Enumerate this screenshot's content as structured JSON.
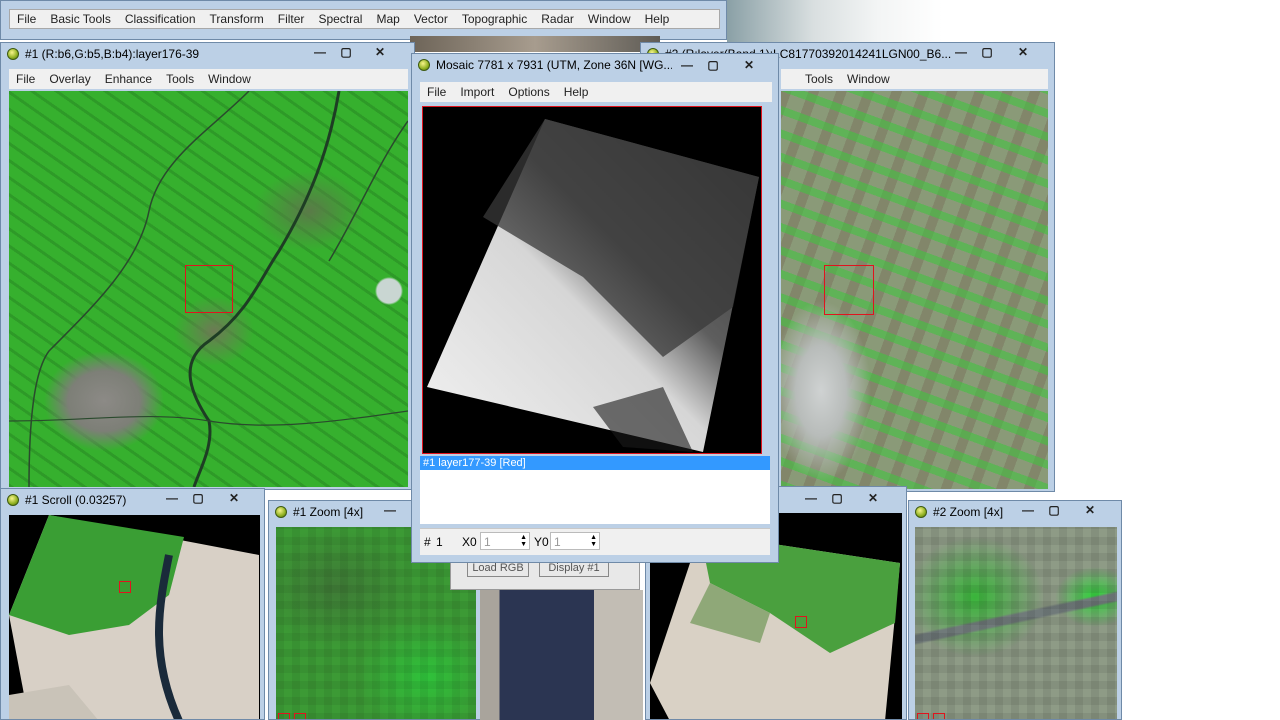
{
  "main_menu": {
    "items": [
      "File",
      "Basic Tools",
      "Classification",
      "Transform",
      "Filter",
      "Spectral",
      "Map",
      "Vector",
      "Topographic",
      "Radar",
      "Window",
      "Help"
    ]
  },
  "image1": {
    "title": "#1 (R:b6,G:b5,B:b4):layer176-39",
    "menu": [
      "File",
      "Overlay",
      "Enhance",
      "Tools",
      "Window"
    ]
  },
  "image2": {
    "title": "#2 (R:layer(Band 1):LC81770392014241LGN00_B6...",
    "menu": [
      "Tools",
      "Window"
    ]
  },
  "scroll1": {
    "title": "#1 Scroll (0.03257)"
  },
  "zoom1": {
    "title": "#1 Zoom [4x]"
  },
  "zoom2": {
    "title": "#2 Zoom [4x]"
  },
  "mosaic": {
    "title": "Mosaic 7781 x 7931 (UTM, Zone 36N [WG...",
    "menu": [
      "File",
      "Import",
      "Options",
      "Help"
    ],
    "list_item": "#1 layer177-39 [Red]",
    "footer": {
      "index_label": "#",
      "index_value": "1",
      "x0_label": "X0",
      "x0_value": "1",
      "y0_label": "Y0",
      "y0_value": "1"
    }
  },
  "hidden_dialog": {
    "button1": "Load RGB",
    "button2": "Display #1"
  },
  "controls": {
    "minimize": "—",
    "maximize": "▢",
    "close": "✕"
  },
  "colors": {
    "titlebar": "#bcd0e6",
    "selection": "#3399ff",
    "veg_green": "#2fae2a",
    "desert": "#d9d2c8",
    "red_marker": "#e0141e"
  }
}
